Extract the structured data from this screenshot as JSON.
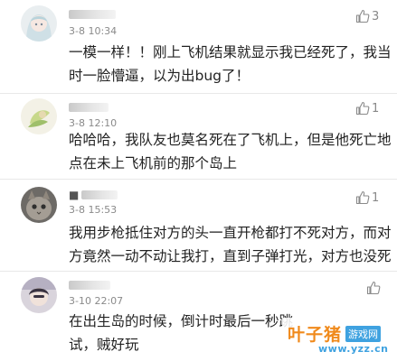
{
  "comments": [
    {
      "time": "3-8 10:34",
      "likes": "3",
      "lines": [
        "一模一样！！刚上飞机结果就显示我已经死了，我当",
        "时一脸懵逼，以为出bug了！"
      ]
    },
    {
      "time": "3-8 12:10",
      "likes": "1",
      "lines": [
        "哈哈哈，我队友也莫名死在了飞机上，但是他死亡地",
        "点在未上飞机前的那个岛上"
      ]
    },
    {
      "name": "■",
      "time": "3-8 15:53",
      "likes": "1",
      "lines": [
        "我用步枪抵住对方的头一直开枪都打不死对方，而对",
        "方竟然一动不动让我打，直到子弹打光，对方也没死"
      ]
    },
    {
      "time": "3-10 22:07",
      "likes": "",
      "lines": [
        "在出生岛的时候，倒计时最后一秒跳",
        "试，贼好玩"
      ]
    }
  ],
  "icons": {
    "like": "thumbs-up-icon"
  },
  "watermark": {
    "brand": "叶子猪",
    "badge": "游戏网",
    "url": "www.yzz.cn"
  },
  "colors": {
    "watermark_orange": "#f08a1c",
    "watermark_blue": "#3fa2e0"
  }
}
